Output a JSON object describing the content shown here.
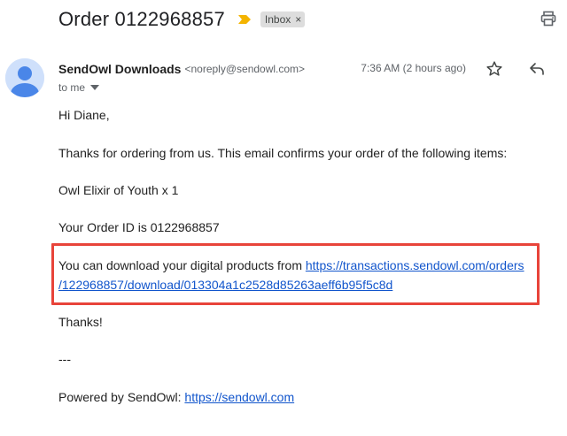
{
  "email": {
    "subject": "Order 0122968857",
    "label": "Inbox",
    "label_remove": "×",
    "sender_name": "SendOwl Downloads",
    "sender_email": "<noreply@sendowl.com>",
    "time": "7:36 AM (2 hours ago)",
    "recipient": "to me",
    "greeting": "Hi Diane,",
    "intro": "Thanks for ordering from us. This email confirms your order of the following items:",
    "item": "Owl Elixir of Youth x 1",
    "order_id_text": "Your Order ID is 0122968857",
    "download_text": "You can download your digital products from ",
    "download_link_line1": "https://transactions.sendowl.com/orders",
    "download_link_line2": "/122968857/download/013304a1c2528d85263aeff6b95f5c8d",
    "thanks": "Thanks!",
    "separator": "---",
    "powered_by": "Powered by SendOwl: ",
    "powered_link": "https://sendowl.com"
  },
  "colors": {
    "highlight_border": "#e8443a",
    "link": "#1155cc",
    "importance_marker": "#f4b400",
    "avatar_bg": "#cfe0fb",
    "avatar_fg": "#4a86e8"
  },
  "icons": [
    "importance-marker-icon",
    "print-icon",
    "avatar-icon",
    "star-icon",
    "reply-icon",
    "caret-down-icon"
  ]
}
